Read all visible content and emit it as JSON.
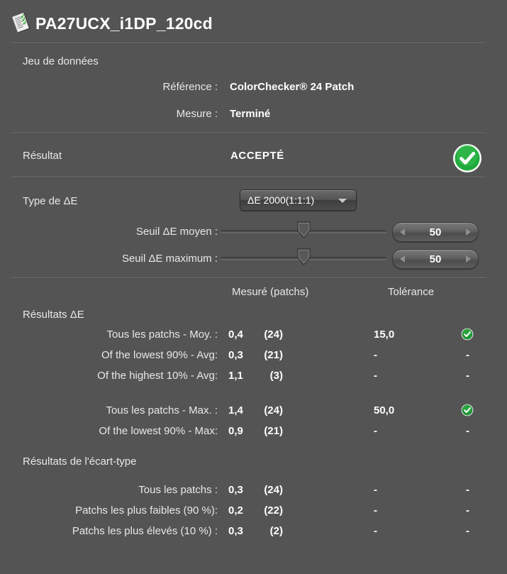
{
  "window": {
    "title": "PA27UCX_i1DP_120cd",
    "icon": "report-document-icon",
    "background_color": "#545454"
  },
  "dataset": {
    "group_label": "Jeu de données",
    "rows": [
      {
        "key": "Référence :",
        "value": "ColorChecker® 24 Patch"
      },
      {
        "key": "Mesure :",
        "value": "Terminé"
      }
    ]
  },
  "result": {
    "label": "Résultat",
    "value": "ACCEPTÉ",
    "status_icon": "green-check-circle-icon",
    "status_color": "#1faa3d"
  },
  "delta_e": {
    "type_label": "Type de ΔE",
    "type_selected": "ΔE 2000(1:1:1)",
    "type_options": [
      "ΔE 2000(1:1:1)"
    ],
    "sliders": [
      {
        "label": "Seuil ΔE moyen :",
        "value": "50",
        "position_pct": 50
      },
      {
        "label": "Seuil ΔE maximum :",
        "value": "50",
        "position_pct": 50
      }
    ]
  },
  "table": {
    "columns": {
      "measured": "Mesuré (patchs)",
      "tolerance": "Tolérance"
    },
    "groups": [
      {
        "title": "Résultats ΔE",
        "rows": [
          {
            "label": "Tous les patchs - Moy. :",
            "value": "0,4",
            "count": "(24)",
            "tolerance": "15,0",
            "status": "ok"
          },
          {
            "label": "Of the lowest 90% - Avg:",
            "value": "0,3",
            "count": "(21)",
            "tolerance": "-",
            "status": "dash"
          },
          {
            "label": "Of the highest 10% - Avg:",
            "value": "1,1",
            "count": "(3)",
            "tolerance": "-",
            "status": "dash"
          },
          {
            "label": "",
            "value": "",
            "count": "",
            "tolerance": "",
            "status": "spacer"
          },
          {
            "label": "Tous les patchs - Max. :",
            "value": "1,4",
            "count": "(24)",
            "tolerance": "50,0",
            "status": "ok"
          },
          {
            "label": "Of the lowest 90% - Max:",
            "value": "0,9",
            "count": "(21)",
            "tolerance": "-",
            "status": "dash"
          }
        ]
      },
      {
        "title": "Résultats de l'écart-type",
        "rows": [
          {
            "label": "Tous les patchs :",
            "value": "0,3",
            "count": "(24)",
            "tolerance": "-",
            "status": "dash"
          },
          {
            "label": "Patchs les plus faibles (90 %):",
            "value": "0,2",
            "count": "(22)",
            "tolerance": "-",
            "status": "dash"
          },
          {
            "label": "Patchs les plus élevés (10 %) :",
            "value": "0,3",
            "count": "(2)",
            "tolerance": "-",
            "status": "dash"
          }
        ]
      }
    ]
  }
}
